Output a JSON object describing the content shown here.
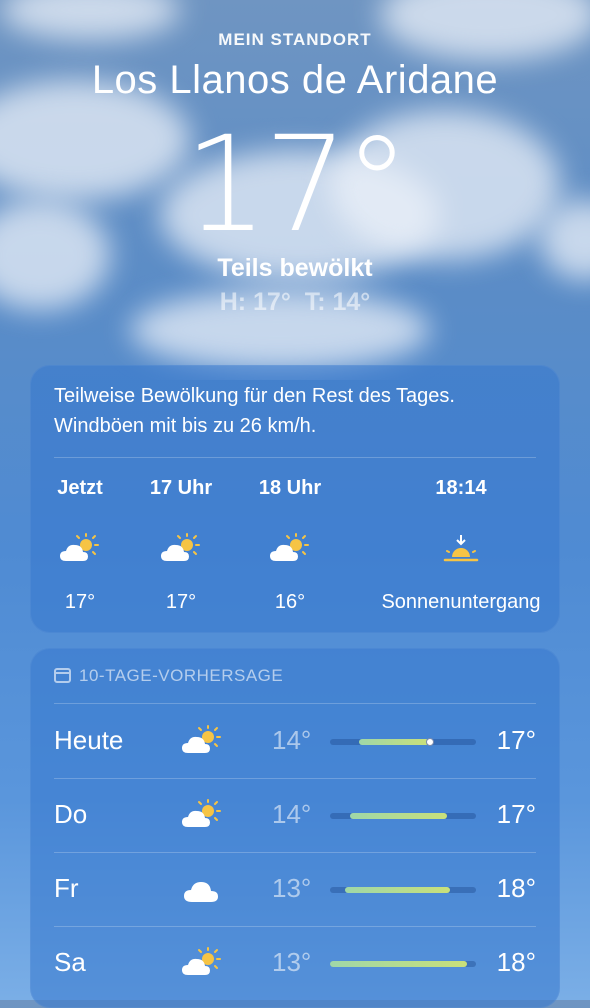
{
  "location_label": "MEIN STANDORT",
  "city": "Los Llanos de Aridane",
  "temperature": "17°",
  "condition": "Teils bewölkt",
  "high_low": "H: 17°  T: 14°",
  "summary_line1": "Teilweise Bewölkung für den Rest des Tages.",
  "summary_line2": "Windböen mit bis zu 26 km/h.",
  "hourly": [
    {
      "label": "Jetzt",
      "icon": "partly-cloudy-icon",
      "temp": "17°"
    },
    {
      "label": "17 Uhr",
      "icon": "partly-cloudy-icon",
      "temp": "17°"
    },
    {
      "label": "18 Uhr",
      "icon": "partly-cloudy-icon",
      "temp": "16°"
    },
    {
      "label": "18:14",
      "icon": "sunset-icon",
      "temp": "Sonnenuntergang"
    }
  ],
  "forecast_title": "10-TAGE-VORHERSAGE",
  "forecast": [
    {
      "day": "Heute",
      "icon": "partly-cloudy-icon",
      "low": "14°",
      "high": "17°",
      "range_start": 0.2,
      "range_end": 0.68,
      "current": 0.68
    },
    {
      "day": "Do",
      "icon": "partly-cloudy-icon",
      "low": "14°",
      "high": "17°",
      "range_start": 0.14,
      "range_end": 0.8
    },
    {
      "day": "Fr",
      "icon": "cloudy-icon",
      "low": "13°",
      "high": "18°",
      "range_start": 0.1,
      "range_end": 0.82
    },
    {
      "day": "Sa",
      "icon": "partly-cloudy-icon",
      "low": "13°",
      "high": "18°",
      "range_start": 0.0,
      "range_end": 0.94
    }
  ],
  "colors": {
    "sun": "#f6c445",
    "cloud": "#ffffff",
    "card": "#3678cd"
  }
}
